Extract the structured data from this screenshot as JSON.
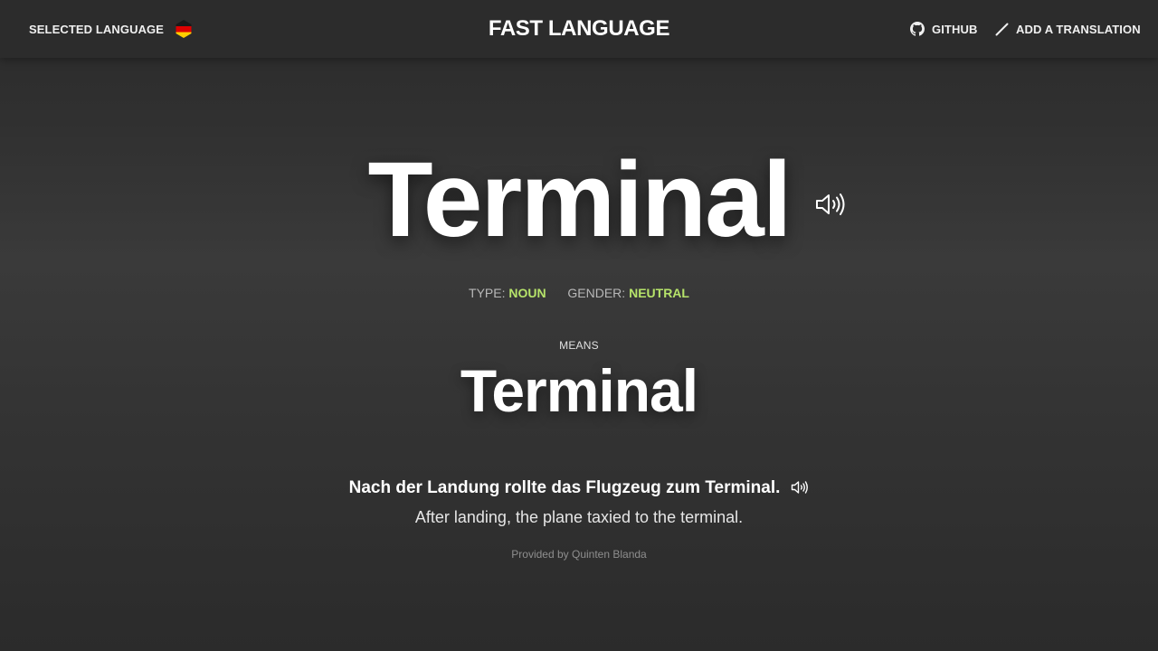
{
  "header": {
    "language_label": "SELECTED LANGUAGE",
    "language_flag": "germany-flag-icon",
    "logo": "FAST LANGUAGE",
    "github_label": "GITHUB",
    "github_icon": "github-icon",
    "add_translation_label": "ADD A TRANSLATION",
    "add_translation_icon": "pencil-icon"
  },
  "word": {
    "text": "Terminal",
    "type_label": "TYPE:",
    "type_value": "NOUN",
    "gender_label": "GENDER:",
    "gender_value": "NEUTRAL",
    "speaker_icon": "speaker-icon"
  },
  "meaning": {
    "label": "MEANS",
    "text": "Terminal"
  },
  "example": {
    "sentence": "Nach der Landung rollte das Flugzeug zum Terminal.",
    "translation": "After landing, the plane taxied to the terminal.",
    "speaker_icon": "speaker-icon"
  },
  "credit": "Provided by Quinten Blanda",
  "colors": {
    "accent": "#b6e36a",
    "background": "#333333",
    "header_background": "#2c2c2c",
    "text": "#ffffff",
    "muted_text": "#b8b8b8"
  }
}
